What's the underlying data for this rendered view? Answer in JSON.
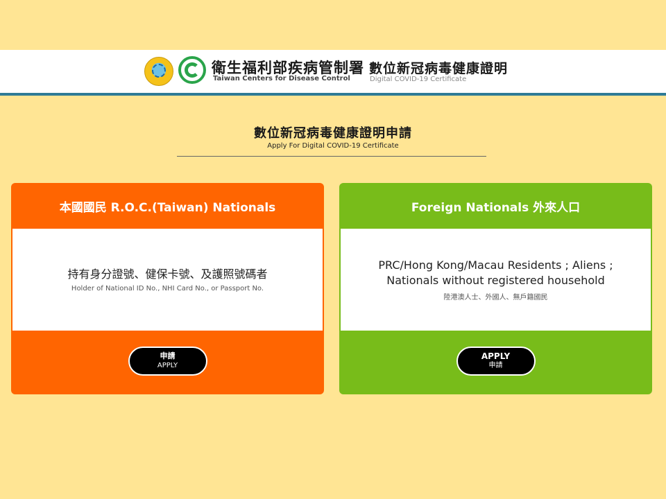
{
  "header": {
    "org_zh": "衛生福利部疾病管制署",
    "org_en": "Taiwan Centers for Disease Control",
    "cert_zh": "數位新冠病毒健康證明",
    "cert_en": "Digital COVID-19 Certificate",
    "icons": [
      "ministry-seal-icon",
      "cdc-logo-icon"
    ]
  },
  "page": {
    "title_zh": "數位新冠病毒健康證明申請",
    "title_en": "Apply For Digital COVID-19 Certificate"
  },
  "cards": {
    "nationals": {
      "heading": "本國國民 R.O.C.(Taiwan) Nationals",
      "body_main": "持有身分證號、健保卡號、及護照號碼者",
      "body_sub": "Holder of National ID No., NHI Card No., or Passport No.",
      "button_top": "申請",
      "button_bottom": "APPLY",
      "color": "#FF6501"
    },
    "foreign": {
      "heading": "Foreign Nationals 外來人口",
      "body_line1": "PRC/Hong Kong/Macau Residents ; Aliens ;",
      "body_line2": "Nationals without registered household",
      "body_sub": "陸港澳人士、外國人、無戶籍國民",
      "button_top": "APPLY",
      "button_bottom": "申請",
      "color": "#78BC1A"
    }
  },
  "colors": {
    "background": "#FFE594",
    "header_border": "#2E7B97",
    "button": "#000000"
  }
}
